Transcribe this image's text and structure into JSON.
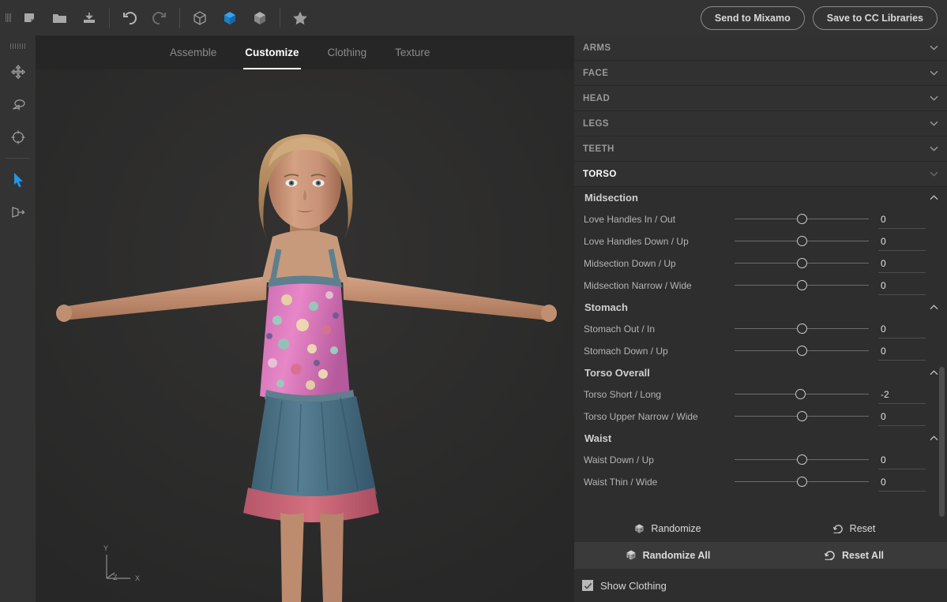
{
  "toolbar": {
    "grip": "drag-grip",
    "buttons": [
      {
        "name": "new-icon",
        "label": "New"
      },
      {
        "name": "open-folder-icon",
        "label": "Open"
      },
      {
        "name": "import-icon",
        "label": "Import"
      },
      {
        "name": "undo-icon",
        "label": "Undo"
      },
      {
        "name": "redo-icon",
        "label": "Redo"
      },
      {
        "name": "cube-wireframe-icon",
        "label": "Wireframe"
      },
      {
        "name": "cube-solid-icon",
        "label": "Solid"
      },
      {
        "name": "cube-shaded-icon",
        "label": "Shaded"
      },
      {
        "name": "star-icon",
        "label": "Favorites"
      }
    ],
    "send_to_mixamo": "Send to Mixamo",
    "save_to_cc_libraries": "Save to CC Libraries",
    "accent_blue": "#1b8fe0"
  },
  "left_rail": {
    "items": [
      {
        "name": "pan-tool",
        "active": false
      },
      {
        "name": "orbit-tool",
        "active": false
      },
      {
        "name": "target-tool",
        "active": false
      },
      {
        "name": "select-tool",
        "active": true
      },
      {
        "name": "perspective-tool",
        "active": false
      }
    ]
  },
  "tabs": [
    {
      "label": "Assemble",
      "active": false
    },
    {
      "label": "Customize",
      "active": true
    },
    {
      "label": "Clothing",
      "active": false
    },
    {
      "label": "Texture",
      "active": false
    }
  ],
  "viewport": {
    "axis_y": "Y",
    "axis_x": "X",
    "axis_z": "Z"
  },
  "panel": {
    "sections": [
      {
        "label": "ARMS",
        "open": false
      },
      {
        "label": "FACE",
        "open": false
      },
      {
        "label": "HEAD",
        "open": false
      },
      {
        "label": "LEGS",
        "open": false
      },
      {
        "label": "TEETH",
        "open": false
      },
      {
        "label": "TORSO",
        "open": true
      }
    ],
    "groups": [
      {
        "label": "Midsection",
        "expanded": true,
        "sliders": [
          {
            "label": "Love Handles In / Out",
            "value": "0",
            "min": -100,
            "max": 100,
            "pos": 0
          },
          {
            "label": "Love Handles Down / Up",
            "value": "0",
            "min": -100,
            "max": 100,
            "pos": 0
          },
          {
            "label": "Midsection Down / Up",
            "value": "0",
            "min": -100,
            "max": 100,
            "pos": 0
          },
          {
            "label": "Midsection Narrow / Wide",
            "value": "0",
            "min": -100,
            "max": 100,
            "pos": 0
          }
        ]
      },
      {
        "label": "Stomach",
        "expanded": true,
        "sliders": [
          {
            "label": "Stomach Out / In",
            "value": "0",
            "min": -100,
            "max": 100,
            "pos": 0
          },
          {
            "label": "Stomach Down / Up",
            "value": "0",
            "min": -100,
            "max": 100,
            "pos": 0
          }
        ]
      },
      {
        "label": "Torso Overall",
        "expanded": true,
        "sliders": [
          {
            "label": "Torso Short / Long",
            "value": "-2",
            "min": -100,
            "max": 100,
            "pos": -2
          },
          {
            "label": "Torso Upper Narrow / Wide",
            "value": "0",
            "min": -100,
            "max": 100,
            "pos": 0
          }
        ]
      },
      {
        "label": "Waist",
        "expanded": true,
        "sliders": [
          {
            "label": "Waist Down / Up",
            "value": "0",
            "min": -100,
            "max": 100,
            "pos": 0
          },
          {
            "label": "Waist Thin / Wide",
            "value": "0",
            "min": -100,
            "max": 100,
            "pos": 0
          }
        ]
      }
    ],
    "actions": {
      "randomize": "Randomize",
      "reset": "Reset",
      "randomize_all": "Randomize All",
      "reset_all": "Reset All"
    },
    "show_clothing": {
      "label": "Show Clothing",
      "checked": true
    }
  }
}
